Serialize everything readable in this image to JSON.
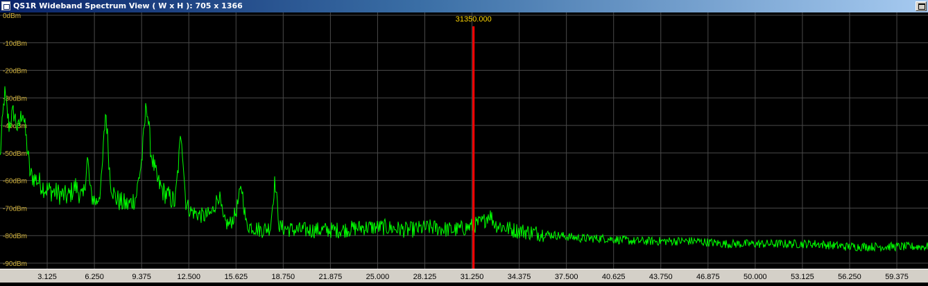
{
  "window": {
    "title": "QS1R Wideband Spectrum View ( W x H ): 705 x 1366",
    "maximize_icon": "window-box-icon",
    "app_icon": "window-app-icon"
  },
  "colors": {
    "background": "#000000",
    "grid": "#4a4a4a",
    "trace": "#00ff00",
    "marker": "#ff0000",
    "marker_label": "#ffd700",
    "db_label": "#d4b43c",
    "freq_label": "#000000",
    "bottombar": "#d4d0c8"
  },
  "marker": {
    "frequency": 31.35,
    "label": "31350.000"
  },
  "chart_data": {
    "type": "line",
    "title": "",
    "xlabel": "",
    "ylabel": "",
    "x_range": [
      0,
      61.44
    ],
    "y_range": [
      -90,
      0
    ],
    "grid": true,
    "y_ticks": [
      {
        "value": 0,
        "label": "0dBm"
      },
      {
        "value": -10,
        "label": "-10dBm"
      },
      {
        "value": -20,
        "label": "-20dBm"
      },
      {
        "value": -30,
        "label": "-30dBm"
      },
      {
        "value": -40,
        "label": "-40dBm"
      },
      {
        "value": -50,
        "label": "-50dBm"
      },
      {
        "value": -60,
        "label": "-60dBm"
      },
      {
        "value": -70,
        "label": "-70dBm"
      },
      {
        "value": -80,
        "label": "-80dBm"
      },
      {
        "value": -90,
        "label": "-90dBm"
      }
    ],
    "x_ticks": [
      {
        "value": 3.125,
        "label": "3.125"
      },
      {
        "value": 6.25,
        "label": "6.250"
      },
      {
        "value": 9.375,
        "label": "9.375"
      },
      {
        "value": 12.5,
        "label": "12.500"
      },
      {
        "value": 15.625,
        "label": "15.625"
      },
      {
        "value": 18.75,
        "label": "18.750"
      },
      {
        "value": 21.875,
        "label": "21.875"
      },
      {
        "value": 25.0,
        "label": "25.000"
      },
      {
        "value": 28.125,
        "label": "28.125"
      },
      {
        "value": 31.25,
        "label": "31.250"
      },
      {
        "value": 34.375,
        "label": "34.375"
      },
      {
        "value": 37.5,
        "label": "37.500"
      },
      {
        "value": 40.625,
        "label": "40.625"
      },
      {
        "value": 43.75,
        "label": "43.750"
      },
      {
        "value": 46.875,
        "label": "46.875"
      },
      {
        "value": 50.0,
        "label": "50.000"
      },
      {
        "value": 53.125,
        "label": "53.125"
      },
      {
        "value": 56.25,
        "label": "56.250"
      },
      {
        "value": 59.375,
        "label": "59.375"
      }
    ],
    "series": [
      {
        "points": [
          [
            0.0,
            -52
          ],
          [
            0.3,
            -28
          ],
          [
            0.6,
            -40
          ],
          [
            0.9,
            -35
          ],
          [
            1.2,
            -42
          ],
          [
            1.5,
            -34
          ],
          [
            1.8,
            -48
          ],
          [
            2.0,
            -58
          ],
          [
            2.5,
            -60
          ],
          [
            3.0,
            -63
          ],
          [
            3.5,
            -64
          ],
          [
            4.0,
            -65
          ],
          [
            4.5,
            -66
          ],
          [
            5.0,
            -62
          ],
          [
            5.5,
            -67
          ],
          [
            5.8,
            -52
          ],
          [
            6.0,
            -65
          ],
          [
            6.4,
            -68
          ],
          [
            6.7,
            -62
          ],
          [
            7.0,
            -34
          ],
          [
            7.3,
            -60
          ],
          [
            7.6,
            -66
          ],
          [
            8.0,
            -68
          ],
          [
            8.5,
            -69
          ],
          [
            9.0,
            -66
          ],
          [
            9.4,
            -52
          ],
          [
            9.7,
            -31
          ],
          [
            10.0,
            -50
          ],
          [
            10.4,
            -60
          ],
          [
            10.8,
            -64
          ],
          [
            11.2,
            -66
          ],
          [
            11.6,
            -68
          ],
          [
            12.0,
            -42
          ],
          [
            12.3,
            -68
          ],
          [
            12.6,
            -71
          ],
          [
            13.0,
            -72
          ],
          [
            13.5,
            -73
          ],
          [
            14.0,
            -72
          ],
          [
            14.5,
            -65
          ],
          [
            14.8,
            -75
          ],
          [
            15.2,
            -76
          ],
          [
            15.6,
            -72
          ],
          [
            16.0,
            -62
          ],
          [
            16.3,
            -76
          ],
          [
            16.8,
            -77
          ],
          [
            17.3,
            -78
          ],
          [
            17.9,
            -77
          ],
          [
            18.2,
            -60
          ],
          [
            18.5,
            -77
          ],
          [
            19.5,
            -78
          ],
          [
            21.0,
            -78
          ],
          [
            22.5,
            -78
          ],
          [
            24.0,
            -77
          ],
          [
            25.5,
            -77
          ],
          [
            27.0,
            -78
          ],
          [
            28.5,
            -77
          ],
          [
            30.0,
            -78
          ],
          [
            31.0,
            -77
          ],
          [
            32.0,
            -75
          ],
          [
            32.4,
            -72
          ],
          [
            32.8,
            -76
          ],
          [
            34.0,
            -78
          ],
          [
            35.5,
            -79
          ],
          [
            37.0,
            -80
          ],
          [
            38.5,
            -81
          ],
          [
            40.0,
            -81
          ],
          [
            42.0,
            -82
          ],
          [
            44.0,
            -82
          ],
          [
            46.0,
            -82
          ],
          [
            48.0,
            -83
          ],
          [
            50.0,
            -83
          ],
          [
            52.0,
            -83
          ],
          [
            54.0,
            -83
          ],
          [
            56.0,
            -84
          ],
          [
            58.0,
            -84
          ],
          [
            60.0,
            -84
          ],
          [
            61.44,
            -84
          ]
        ]
      }
    ]
  }
}
